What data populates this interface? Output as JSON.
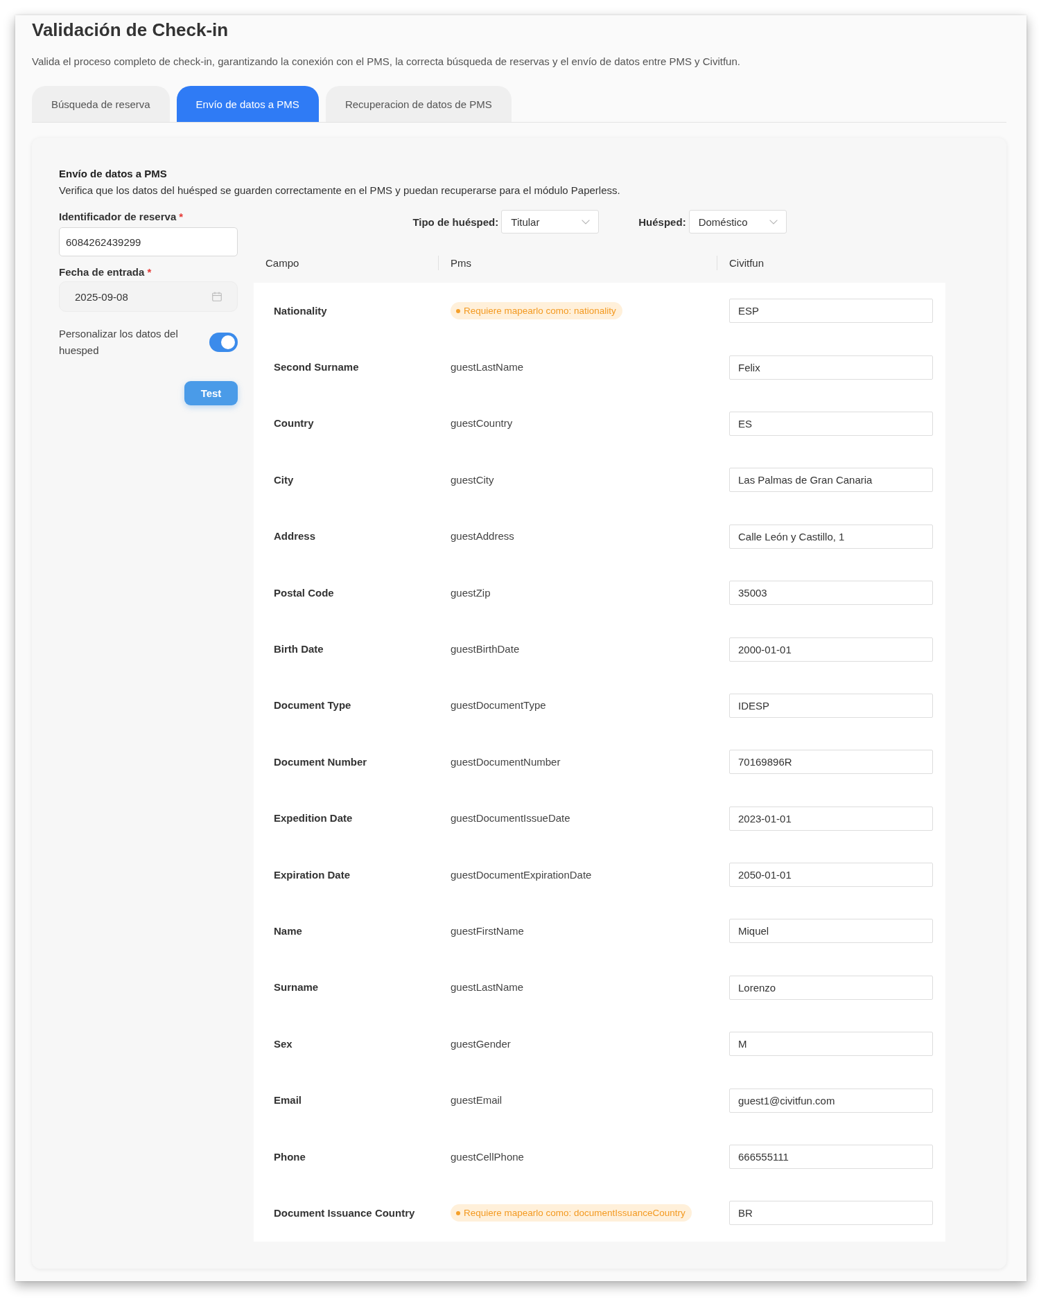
{
  "window": {
    "title": "Validación de Check-in",
    "description": "Valida el proceso completo de check-in, garantizando la conexión con el PMS, la correcta búsqueda de reservas y el envío de datos entre PMS y Civitfun."
  },
  "tabs": [
    {
      "label": "Búsqueda de reserva",
      "selected": false
    },
    {
      "label": "Envío de datos a PMS",
      "selected": true
    },
    {
      "label": "Recuperacion de datos de PMS",
      "selected": false
    }
  ],
  "panel": {
    "title": "Envío de datos a PMS",
    "description": "Verifica que los datos del huésped se guarden correctamente en el PMS y puedan recuperarse para el módulo Paperless."
  },
  "form": {
    "fields": [
      {
        "kind": "text",
        "label": "Identificador de reserva",
        "required_mark": "*",
        "value": "6084262439299"
      },
      {
        "kind": "date",
        "label": "Fecha de entrada",
        "required_mark": "*",
        "value": "2025-09-08"
      }
    ],
    "customize_toggle": {
      "label": "Personalizar los datos del huesped",
      "on": true
    },
    "test_button": "Test"
  },
  "filters": [
    {
      "label": "Tipo de huésped:",
      "value": "Titular"
    },
    {
      "label": "Huésped:",
      "value": "Doméstico"
    }
  ],
  "table": {
    "columns": [
      "Campo",
      "Pms",
      "Civitfun"
    ],
    "rows": [
      {
        "field": "Nationality",
        "pms": {
          "kind": "warning",
          "text": "Requiere mapearlo como: nationality"
        },
        "civitfun": "ESP"
      },
      {
        "field": "Second Surname",
        "pms": {
          "kind": "text",
          "text": "guestLastName"
        },
        "civitfun": "Felix"
      },
      {
        "field": "Country",
        "pms": {
          "kind": "text",
          "text": "guestCountry"
        },
        "civitfun": "ES"
      },
      {
        "field": "City",
        "pms": {
          "kind": "text",
          "text": "guestCity"
        },
        "civitfun": "Las Palmas de Gran Canaria"
      },
      {
        "field": "Address",
        "pms": {
          "kind": "text",
          "text": "guestAddress"
        },
        "civitfun": "Calle León y Castillo, 1"
      },
      {
        "field": "Postal Code",
        "pms": {
          "kind": "text",
          "text": "guestZip"
        },
        "civitfun": "35003"
      },
      {
        "field": "Birth Date",
        "pms": {
          "kind": "text",
          "text": "guestBirthDate"
        },
        "civitfun": "2000-01-01"
      },
      {
        "field": "Document Type",
        "pms": {
          "kind": "text",
          "text": "guestDocumentType"
        },
        "civitfun": "IDESP"
      },
      {
        "field": "Document Number",
        "pms": {
          "kind": "text",
          "text": "guestDocumentNumber"
        },
        "civitfun": "70169896R"
      },
      {
        "field": "Expedition Date",
        "pms": {
          "kind": "text",
          "text": "guestDocumentIssueDate"
        },
        "civitfun": "2023-01-01"
      },
      {
        "field": "Expiration Date",
        "pms": {
          "kind": "text",
          "text": "guestDocumentExpirationDate"
        },
        "civitfun": "2050-01-01"
      },
      {
        "field": "Name",
        "pms": {
          "kind": "text",
          "text": "guestFirstName"
        },
        "civitfun": "Miquel"
      },
      {
        "field": "Surname",
        "pms": {
          "kind": "text",
          "text": "guestLastName"
        },
        "civitfun": "Lorenzo"
      },
      {
        "field": "Sex",
        "pms": {
          "kind": "text",
          "text": "guestGender"
        },
        "civitfun": "M"
      },
      {
        "field": "Email",
        "pms": {
          "kind": "text",
          "text": "guestEmail"
        },
        "civitfun": "guest1@civitfun.com"
      },
      {
        "field": "Phone",
        "pms": {
          "kind": "text",
          "text": "guestCellPhone"
        },
        "civitfun": "666555111"
      },
      {
        "field": "Document Issuance Country",
        "pms": {
          "kind": "warning",
          "text": "Requiere mapearlo como: documentIssuanceCountry"
        },
        "civitfun": "BR"
      }
    ]
  }
}
